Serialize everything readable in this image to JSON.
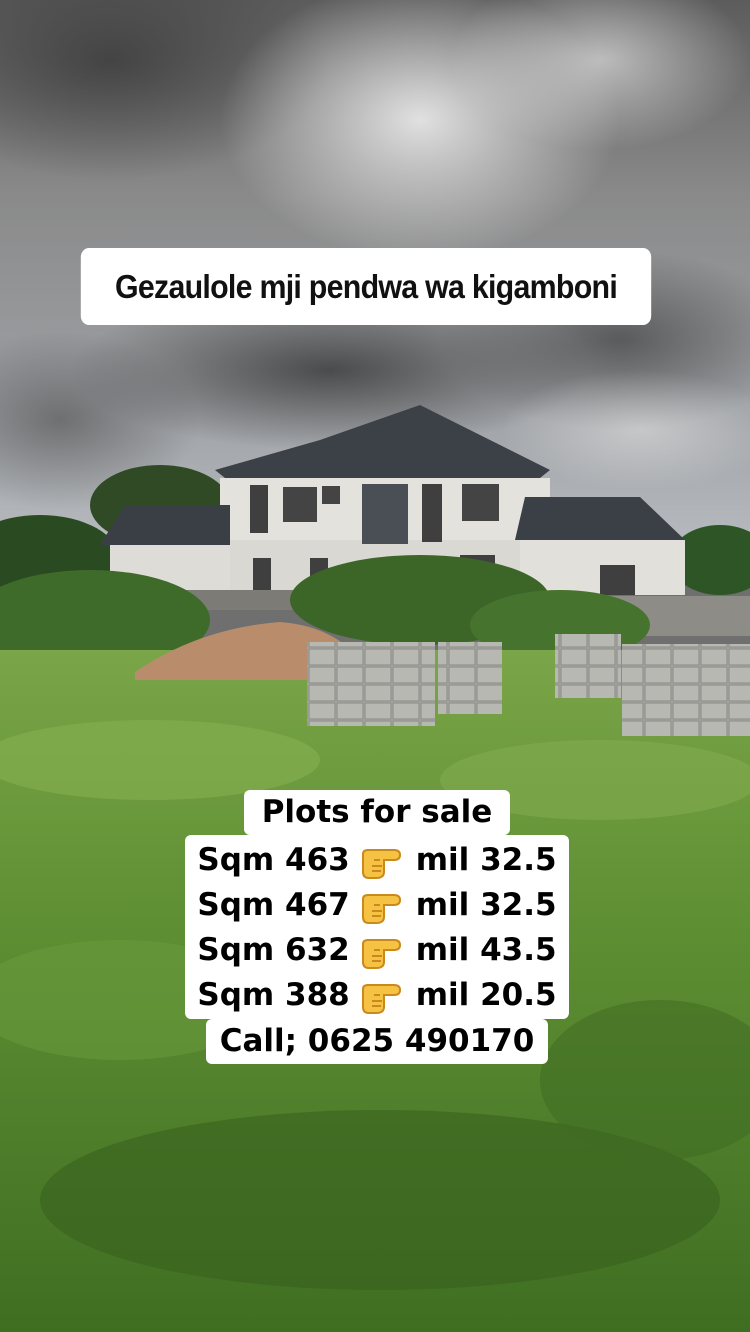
{
  "title_overlay": "Gezaulole mji pendwa wa kigamboni",
  "caption": {
    "heading": "Plots for sale",
    "listings": [
      {
        "size": "Sqm 463",
        "price": "mil 32.5"
      },
      {
        "size": "Sqm 467",
        "price": "mil 32.5"
      },
      {
        "size": "Sqm 632",
        "price": "mil 43.5"
      },
      {
        "size": "Sqm 388",
        "price": "mil 20.5"
      }
    ],
    "contact": "Call; 0625 490170"
  },
  "icons": [
    "pointing-hand-icon"
  ],
  "colors": {
    "caption_bg": "#ffffff",
    "text": "#000000",
    "grass": "#5a8a2e",
    "sky": "#7a7a7a"
  }
}
